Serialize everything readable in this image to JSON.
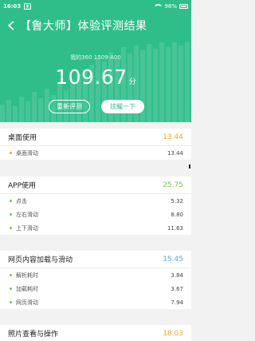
{
  "status_bar": {
    "time": "16:03",
    "notif": "鲁",
    "battery": "98%"
  },
  "header": {
    "title": "【鲁大师】体验评测结果",
    "device": "我的360 1509-A00",
    "score": "109.67",
    "score_unit": "分",
    "retest_label": "重新评测",
    "show_label": "炫耀一下"
  },
  "colors": {
    "primary": "#2fbe8a",
    "orange": "#f5a623",
    "green": "#7ac943",
    "blue": "#4fb0e8"
  },
  "sections": [
    {
      "title": "桌面使用",
      "value": "13.44",
      "color": "#f5a623",
      "items": [
        {
          "label": "桌面滑动",
          "value": "13.44"
        }
      ]
    },
    {
      "title": "APP使用",
      "value": "25.75",
      "color": "#7ac943",
      "items": [
        {
          "label": "点击",
          "value": "5.32"
        },
        {
          "label": "左右滑动",
          "value": "8.80"
        },
        {
          "label": "上下滑动",
          "value": "11.63"
        }
      ]
    },
    {
      "title": "网页内容加载与滑动",
      "value": "15.45",
      "color": "#4fb0e8",
      "items": [
        {
          "label": "解析耗时",
          "value": "3.84"
        },
        {
          "label": "加载耗时",
          "value": "3.67"
        },
        {
          "label": "网页滑动",
          "value": "7.94"
        }
      ]
    },
    {
      "title": "照片查看与操作",
      "value": "18.03",
      "color": "#f5a623",
      "items": []
    }
  ]
}
